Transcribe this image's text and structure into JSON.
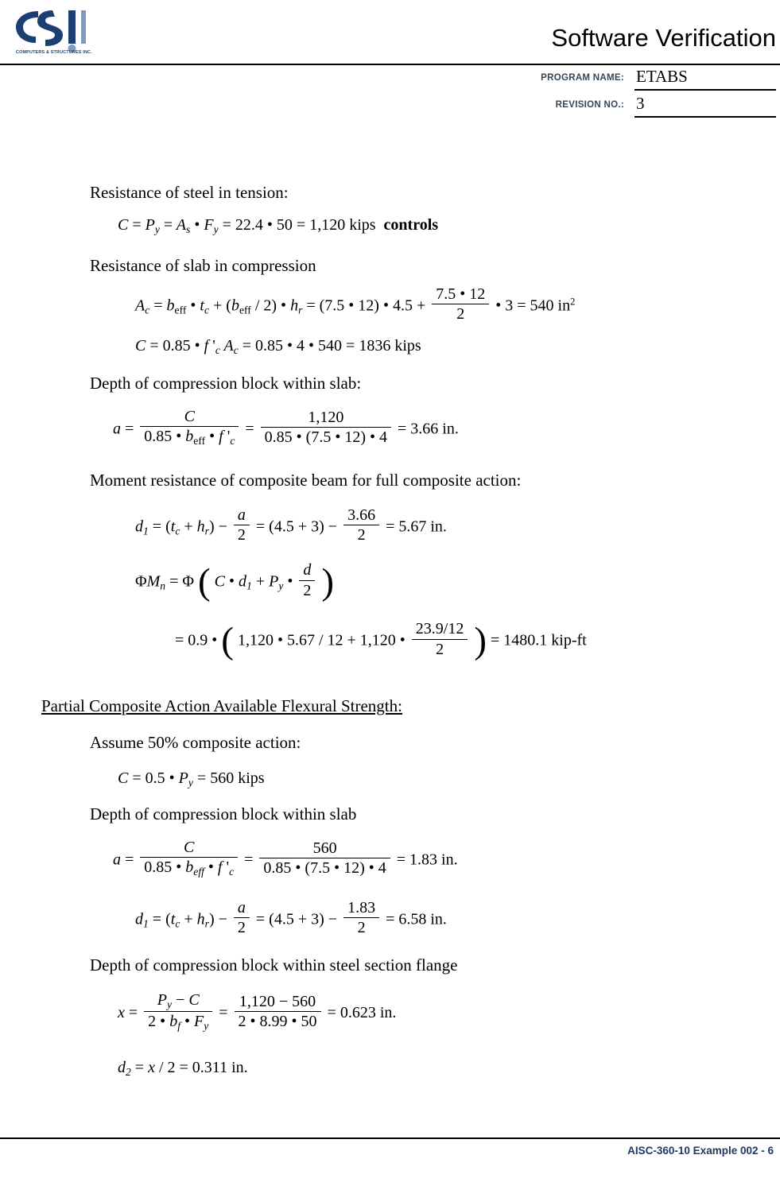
{
  "header": {
    "logo_text": "COMPUTERS & STRUCTURES INC.",
    "title": "Software Verification",
    "program_name_label": "PROGRAM NAME:",
    "program_name_value": "ETABS",
    "revision_label": "REVISION NO.:",
    "revision_value": "3"
  },
  "footer": {
    "reference": "AISC-360-10 Example 002 - 6"
  },
  "body": {
    "p1": "Resistance of steel in tension:",
    "eq1": "C = P_y = A_s • F_y = 22.4 • 50 = 1,120 kips  controls",
    "eq1_controls": "controls",
    "p2": "Resistance of slab in compression",
    "eq2": "A_c = b_eff • t_c + (b_eff / 2) • h_r = (7.5 • 12) • 4.5 + (7.5 • 12)/2 • 3 = 540 in^2",
    "eq3": "C = 0.85 • f'_c A_c = 0.85 • 4 • 540 = 1836 kips",
    "p3": "Depth of compression block within slab:",
    "eq4": "a = C / (0.85 • b_eff • f'_c) = 1,120 / (0.85 • (7.5 • 12) • 4) = 3.66 in.",
    "p4": "Moment resistance of composite beam for full composite action:",
    "eq5": "d_1 = (t_c + h_r) - a/2 = (4.5 + 3) - 3.66/2 = 5.67 in.",
    "eq6_line1": "ΦM_n = Φ ( C • d_1 + P_y • d/2 )",
    "eq6_line2": "= 0.9 • ( 1,120 • 5.67 / 12 + 1,120 • 23.9/12 / 2 ) = 1480.1 kip-ft",
    "section_heading": "Partial Composite Action Available Flexural Strength:",
    "p5": "Assume 50% composite action:",
    "eq7": "C = 0.5 • P_y = 560 kips",
    "p6": "Depth of compression block within slab",
    "eq8": "a = C / (0.85 • b_eff • f'_c) = 560 / (0.85 • (7.5 • 12) • 4) = 1.83 in.",
    "eq9": "d_1 = (t_c + h_r) - a/2 = (4.5 + 3) - 1.83/2 = 6.58 in.",
    "p7": "Depth of compression block within steel section flange",
    "eq10": "x = (P_y - C) / (2 • b_f • F_y) = (1,120 - 560) / (2 • 8.99 • 50) = 0.623 in.",
    "eq11": "d_2 = x / 2 = 0.311 in."
  },
  "values": {
    "As": "22.4",
    "Fy": "50",
    "C_full": "1,120",
    "beff": "7.5",
    "tc": "4.5",
    "hr": "3",
    "Ac": "540",
    "fc": "4",
    "C_slab": "1836",
    "a_full": "3.66",
    "d1_full": "5.67",
    "phi": "0.9",
    "d_total": "23.9/12",
    "PhiMn": "1480.1",
    "C_partial": "560",
    "a_partial": "1.83",
    "d1_partial": "6.58",
    "bf": "8.99",
    "x": "0.623",
    "d2": "0.311"
  }
}
